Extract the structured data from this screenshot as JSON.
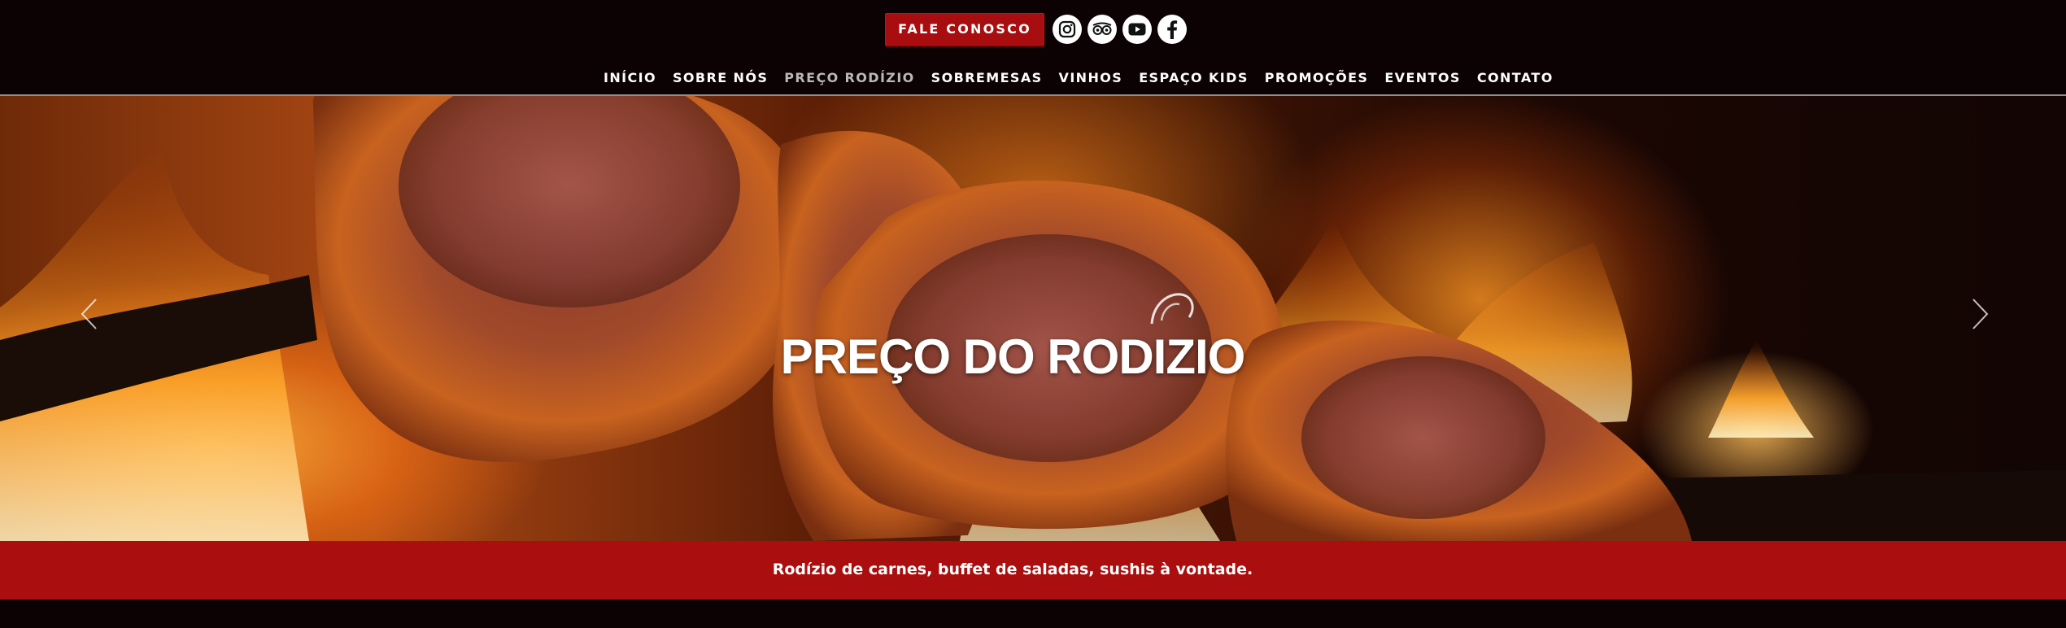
{
  "header": {
    "cta_label": "FALE CONOSCO",
    "socials": [
      {
        "name": "instagram",
        "icon": "instagram-icon"
      },
      {
        "name": "tripadvisor",
        "icon": "tripadvisor-icon"
      },
      {
        "name": "youtube",
        "icon": "youtube-icon"
      },
      {
        "name": "facebook",
        "icon": "facebook-icon"
      }
    ]
  },
  "nav": {
    "items": [
      {
        "label": "INÍCIO"
      },
      {
        "label": "SOBRE NÓS"
      },
      {
        "label": "PREÇO RODÍZIO"
      },
      {
        "label": "SOBREMESAS"
      },
      {
        "label": "VINHOS"
      },
      {
        "label": "ESPAÇO KIDS"
      },
      {
        "label": "PROMOÇÕES"
      },
      {
        "label": "EVENTOS"
      },
      {
        "label": "CONTATO"
      }
    ],
    "active_index": 2
  },
  "hero": {
    "title": "PREÇO DO RODIZIO",
    "prev_icon": "chevron-left-icon",
    "next_icon": "chevron-right-icon"
  },
  "banner": {
    "text": "Rodízio de carnes, buffet de saladas, sushis à vontade."
  },
  "colors": {
    "background": "#0d0203",
    "accent_red": "#aa0e0e",
    "nav_active": "#b9b9b9",
    "text": "#ffffff"
  }
}
